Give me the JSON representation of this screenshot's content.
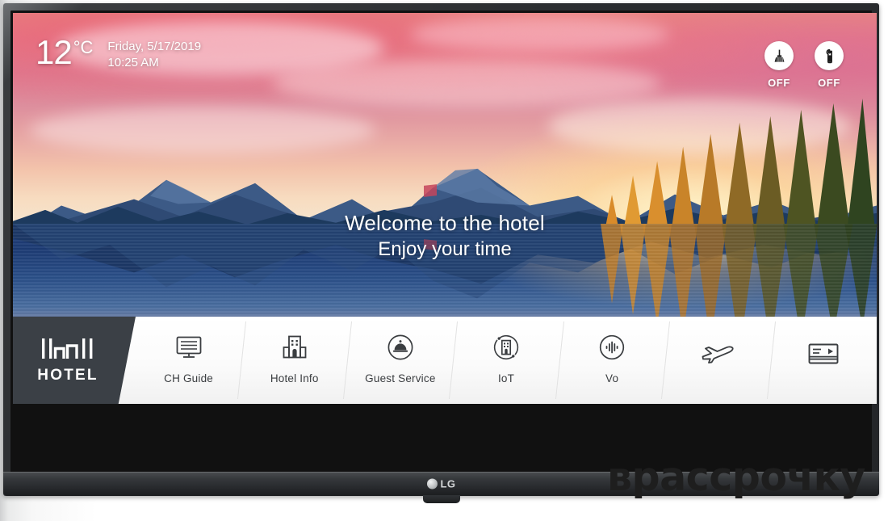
{
  "device": {
    "brand": "LG",
    "screen_kind": "hotel-tv-welcome-screen"
  },
  "status_bar": {
    "temperature": "12",
    "temperature_unit": "°C",
    "date": "Friday, 5/17/2019",
    "time": "10:25 AM"
  },
  "service_toggles": [
    {
      "name": "make-up-room",
      "icon": "broom-icon",
      "state": "OFF"
    },
    {
      "name": "do-not-disturb",
      "icon": "door-hanger-icon",
      "state": "OFF"
    }
  ],
  "welcome": {
    "line1": "Welcome to the hotel",
    "line2": "Enjoy your time"
  },
  "hotel_brand": {
    "label": "HOTEL",
    "icon": "hotel-building-mark"
  },
  "menu": {
    "items": [
      {
        "label": "CH Guide",
        "icon": "tv-guide-icon"
      },
      {
        "label": "Hotel Info",
        "icon": "building-icon"
      },
      {
        "label": "Guest Service",
        "icon": "service-bell-icon"
      },
      {
        "label": "IoT",
        "icon": "iot-orbit-icon"
      },
      {
        "label": "Vo",
        "icon": "voice-wave-icon"
      },
      {
        "label": "",
        "icon": "airplane-icon"
      },
      {
        "label": "",
        "icon": "media-card-icon"
      }
    ]
  },
  "watermark": {
    "text": "врассрочку"
  },
  "colors": {
    "menu_bar_bg": "#ffffff",
    "hotel_block_bg": "#3b4046",
    "icon_stroke": "#3a3d40",
    "overlay_text": "#ffffff",
    "bezel": "#2b2d30"
  }
}
